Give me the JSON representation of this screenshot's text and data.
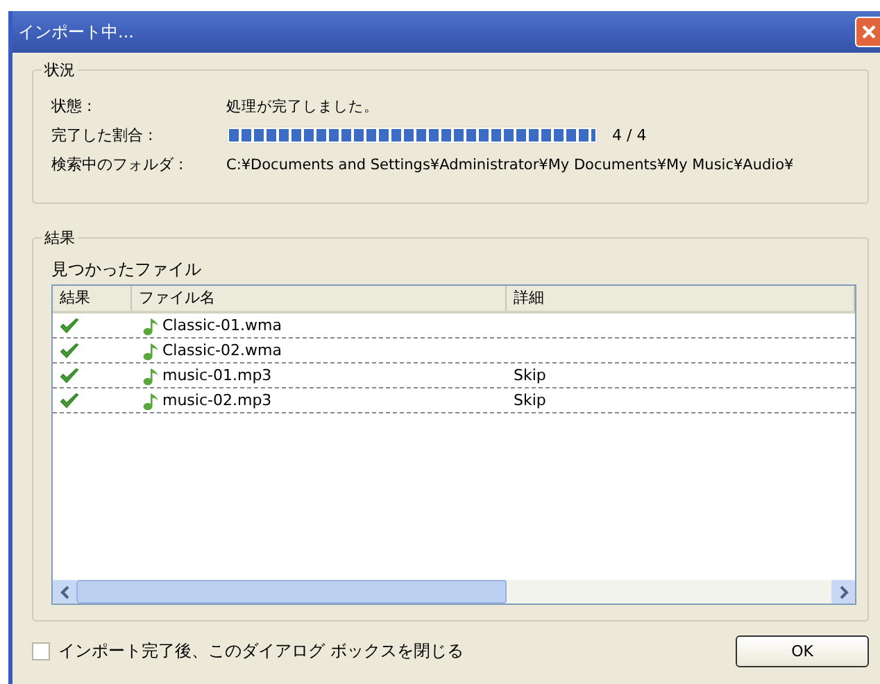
{
  "window": {
    "title": "インポート中..."
  },
  "status_group": {
    "title": "状況",
    "rows": [
      {
        "kind": "text",
        "label": "状態 :",
        "value": "処理が完了しました。"
      },
      {
        "kind": "progress",
        "label": "完了した割合 :",
        "level": 1,
        "value": "4 / 4"
      },
      {
        "kind": "text",
        "label": "検索中のフォルダ :",
        "value": "C:¥Documents and Settings¥Administrator¥My Documents¥My Music¥Audio¥"
      }
    ]
  },
  "results_group": {
    "title": "結果",
    "list_title": "見つかったファイル",
    "columns": [
      "結果",
      "ファイル名",
      "詳細"
    ],
    "rows": [
      {
        "success": true,
        "name": "Classic-01.wma"
      },
      {
        "success": true,
        "name": "Classic-02.wma"
      },
      {
        "success": true,
        "name": "music-01.mp3",
        "detail": "Skip"
      },
      {
        "success": true,
        "name": "music-02.mp3",
        "detail": "Skip"
      }
    ]
  },
  "close_when_done": {
    "label": "インポート完了後、このダイアログ ボックスを閉じる",
    "checked": false
  },
  "buttons": [
    "OK"
  ]
}
